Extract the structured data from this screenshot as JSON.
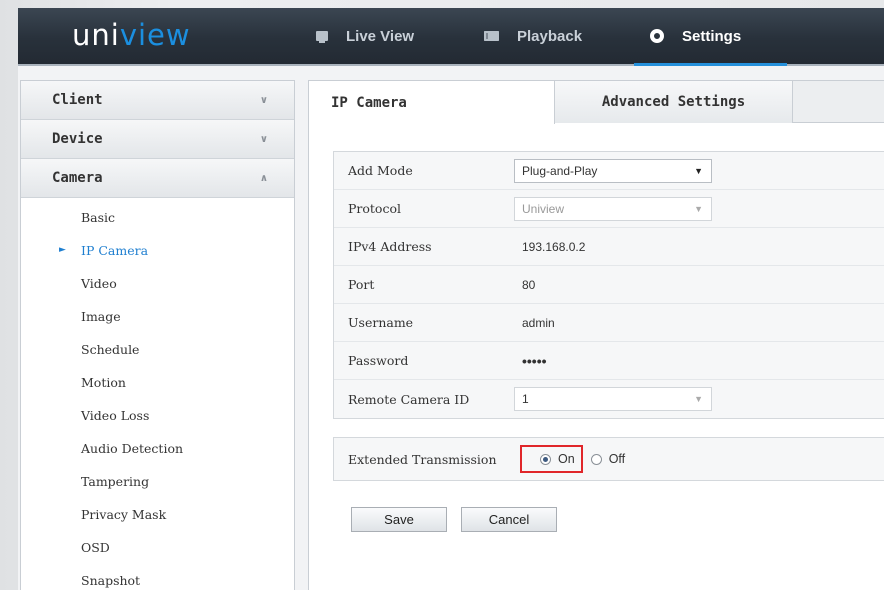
{
  "header": {
    "logo_prefix": "uni",
    "logo_accent": "view",
    "nav": [
      {
        "label": "Live View",
        "icon": "monitor-icon"
      },
      {
        "label": "Playback",
        "icon": "film-icon"
      },
      {
        "label": "Settings",
        "icon": "gear-icon",
        "active": true
      }
    ]
  },
  "sidebar": {
    "sections": [
      {
        "label": "Client",
        "chevron": "∨"
      },
      {
        "label": "Device",
        "chevron": "∨"
      },
      {
        "label": "Camera",
        "chevron": "∧"
      }
    ],
    "items": [
      {
        "label": "Basic"
      },
      {
        "label": "IP Camera",
        "active": true
      },
      {
        "label": "Video"
      },
      {
        "label": "Image"
      },
      {
        "label": "Schedule"
      },
      {
        "label": "Motion"
      },
      {
        "label": "Video Loss"
      },
      {
        "label": "Audio Detection"
      },
      {
        "label": "Tampering"
      },
      {
        "label": "Privacy Mask"
      },
      {
        "label": "OSD"
      },
      {
        "label": "Snapshot"
      }
    ]
  },
  "tabs": [
    {
      "label": "IP Camera",
      "active": true
    },
    {
      "label": "Advanced Settings"
    }
  ],
  "form": {
    "add_mode": {
      "label": "Add Mode",
      "value": "Plug-and-Play"
    },
    "protocol": {
      "label": "Protocol",
      "value": "Uniview"
    },
    "ipv4": {
      "label": "IPv4 Address",
      "value": "193.168.0.2"
    },
    "port": {
      "label": "Port",
      "value": "80"
    },
    "username": {
      "label": "Username",
      "value": "admin"
    },
    "password": {
      "label": "Password",
      "value": "•••••"
    },
    "remote_id": {
      "label": "Remote Camera ID",
      "value": "1"
    }
  },
  "extended": {
    "label": "Extended Transmission",
    "on_label": "On",
    "off_label": "Off",
    "selected": "On"
  },
  "buttons": {
    "save": "Save",
    "cancel": "Cancel"
  },
  "colors": {
    "accent": "#2590db",
    "highlight_border": "#e0262a",
    "active_link": "#1f7fd0"
  }
}
